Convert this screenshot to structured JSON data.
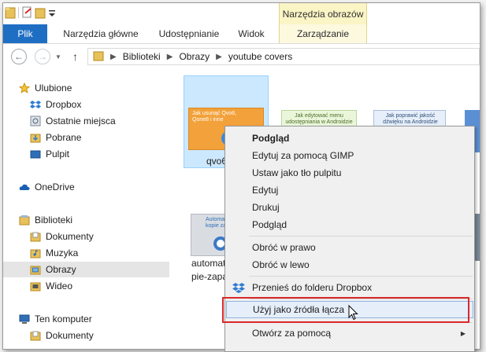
{
  "ribbon": {
    "context_group": "Narzędzia obrazów",
    "tabs": [
      "Plik",
      "Narzędzia główne",
      "Udostępnianie",
      "Widok",
      "Zarządzanie"
    ]
  },
  "address": {
    "breadcrumbs": [
      "Biblioteki",
      "Obrazy",
      "youtube covers"
    ]
  },
  "nav": {
    "favorites": "Ulubione",
    "favorites_items": [
      "Dropbox",
      "Ostatnie miejsca",
      "Pobrane",
      "Pulpit"
    ],
    "onedrive": "OneDrive",
    "libraries": "Biblioteki",
    "libraries_items": [
      "Dokumenty",
      "Muzyka",
      "Obrazy",
      "Wideo"
    ],
    "computer": "Ten komputer",
    "computer_items": [
      "Dokumenty"
    ],
    "selected_item": "Obrazy"
  },
  "files": [
    {
      "label": "qvo6",
      "thumb_text": "Jak usunąć Qvo6, Qone8 i inne"
    },
    {
      "label": "",
      "thumb_text": "Jak edytować menu udostępniania w Androidzie"
    },
    {
      "label": "",
      "thumb_text": "Jak poprawić jakość dźwięku na Androidzie"
    },
    {
      "label": "automat",
      "label2": "pie-zapa",
      "thumb_text": "Automa kopie za"
    }
  ],
  "context_menu": {
    "items": [
      {
        "label": "Podgląd",
        "bold": true
      },
      {
        "label": "Edytuj za pomocą GIMP"
      },
      {
        "label": "Ustaw jako tło pulpitu"
      },
      {
        "label": "Edytuj"
      },
      {
        "label": "Drukuj"
      },
      {
        "label": "Podgląd"
      },
      {
        "label": "Obróć w prawo"
      },
      {
        "label": "Obróć w lewo"
      },
      {
        "label": "Przenieś do folderu Dropbox",
        "icon": "dropbox-icon"
      },
      {
        "label": "Użyj jako źródła łącza",
        "hovered": true
      },
      {
        "label": "Otwórz za pomocą",
        "submenu": true
      }
    ]
  },
  "colors": {
    "file_tab": "#1e6fc4",
    "context_tab": "#fbf4c5",
    "highlight_box": "#d9282b",
    "hover": "#e5eef9"
  }
}
